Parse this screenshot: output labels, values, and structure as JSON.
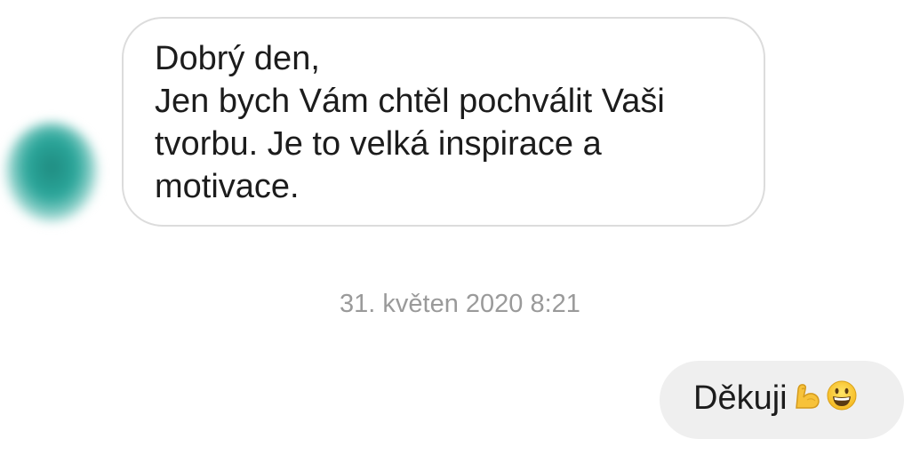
{
  "conversation": {
    "incoming_message": {
      "text": "Dobrý den,\nJen bych Vám chtěl pochválit Vaši\ntvorbu. Je to velká inspirace a\nmotivace."
    },
    "timestamp": "31. květen 2020 8:21",
    "outgoing_message": {
      "text": "Děkuji",
      "emojis": [
        "flexed-biceps-icon",
        "grinning-face-icon"
      ]
    }
  },
  "colors": {
    "incoming_border": "#dcdcdc",
    "outgoing_background": "#efefef",
    "timestamp": "#9a9a9a",
    "avatar": "#2aa69a"
  }
}
